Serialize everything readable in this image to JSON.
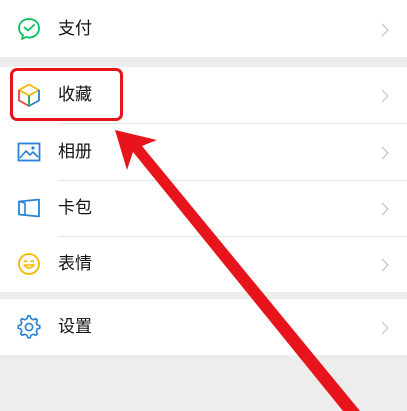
{
  "menu": {
    "group1": {
      "items": [
        {
          "label": "支付",
          "icon": "wechat-pay-icon"
        }
      ]
    },
    "group2": {
      "items": [
        {
          "label": "收藏",
          "icon": "favorites-cube-icon"
        },
        {
          "label": "相册",
          "icon": "album-icon"
        },
        {
          "label": "卡包",
          "icon": "card-wallet-icon"
        },
        {
          "label": "表情",
          "icon": "sticker-smile-icon"
        }
      ]
    },
    "group3": {
      "items": [
        {
          "label": "设置",
          "icon": "settings-gear-icon"
        }
      ]
    }
  },
  "colors": {
    "pay_green": "#07c160",
    "album_blue": "#2782d7",
    "card_blue": "#2782d7",
    "sticker_yellow": "#f5b800",
    "settings_blue": "#2782d7",
    "annotation_red": "#e8141c",
    "background": "#ededed"
  }
}
